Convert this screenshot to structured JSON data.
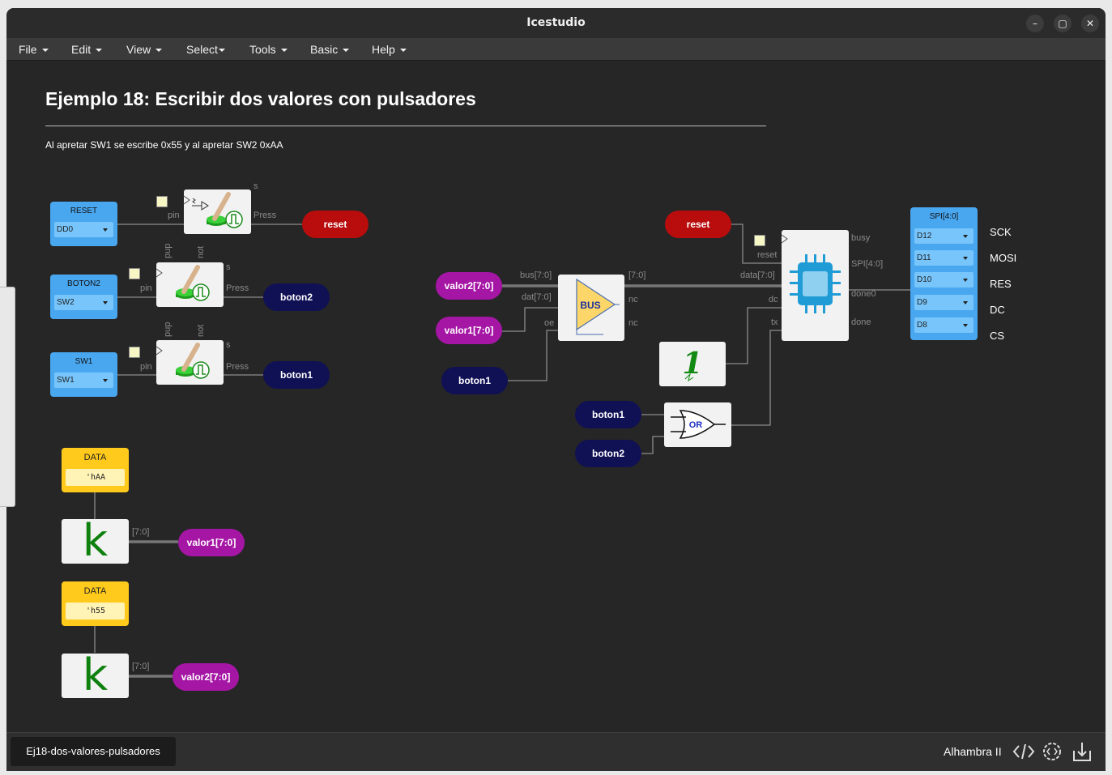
{
  "window": {
    "title": "Icestudio",
    "controls": [
      "–",
      "▢",
      "✕"
    ]
  },
  "menu": [
    "File",
    "Edit",
    "View",
    "Select",
    "Tools",
    "Basic",
    "Help"
  ],
  "project": {
    "title": "Ejemplo 18: Escribir dos valores con pulsadores",
    "description": "Al apretar SW1 se escribe 0x55 y al apretar SW2 0xAA"
  },
  "inputs": [
    {
      "label": "RESET",
      "pin": "DD0"
    },
    {
      "label": "BOTON2",
      "pin": "SW2"
    },
    {
      "label": "SW1",
      "pin": "SW1"
    }
  ],
  "output": {
    "label": "SPI[4:0]",
    "pins": [
      "D12",
      "D11",
      "D10",
      "D9",
      "D8"
    ],
    "names": [
      "SCK",
      "MOSI",
      "RES",
      "DC",
      "CS"
    ]
  },
  "ports": {
    "pin": "pin",
    "s": "s",
    "press": "Press",
    "pup": "pup",
    "not": "not",
    "bus": "bus[7:0]",
    "dat": "dat[7:0]",
    "oe": "oe",
    "out": "[7:0]",
    "nc": "nc",
    "data": "data[7:0]",
    "reset": "reset",
    "busy": "busy",
    "spi": "SPI[4:0]",
    "done0": "done0",
    "done": "done",
    "dc": "dc",
    "tx": "tx"
  },
  "labels": {
    "reset": "reset",
    "boton1": "boton1",
    "boton2": "boton2",
    "valor1": "valor1[7:0]",
    "valor2": "valor2[7:0]"
  },
  "blocks": {
    "bus": "BUS",
    "or": "OR",
    "one": "1"
  },
  "constants": [
    {
      "label": "DATA",
      "value": "'hAA"
    },
    {
      "label": "DATA",
      "value": "'h55"
    }
  ],
  "kletter": "k",
  "statusbar": {
    "file": "Ej18-dos-valores-pulsadores",
    "board": "Alhambra II"
  },
  "colors": {
    "input": "#49a7f0",
    "constant": "#ffca1b",
    "reset_tag": "#b90d0d",
    "button_tag": "#101055",
    "value_tag": "#a516a5"
  }
}
